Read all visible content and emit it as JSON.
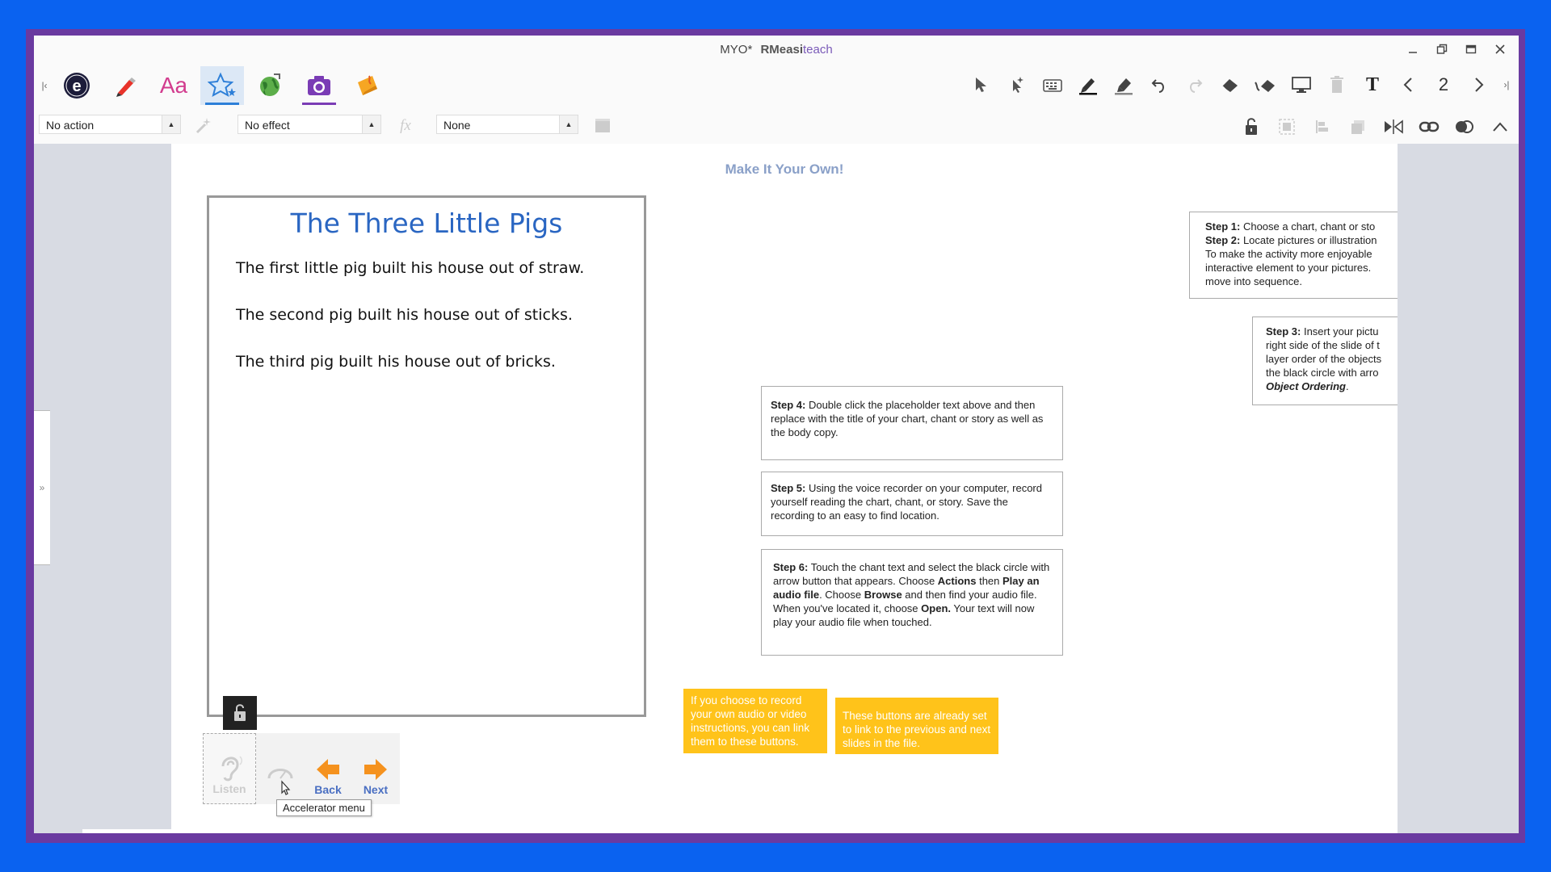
{
  "window": {
    "title": "MYO*",
    "brand_bold": "RM",
    "brand_rest": "easi",
    "brand_accent": "teach",
    "buttons": [
      "minimize-icon",
      "restore-icon",
      "maximize-icon",
      "close-icon"
    ]
  },
  "toolbar": {
    "left_tools": [
      "easiteach-logo",
      "pen-tool",
      "text-tool",
      "star-tool",
      "globe-tool",
      "camera-tool",
      "sticky-tool"
    ],
    "page_number": "2"
  },
  "properties": {
    "action_value": "No action",
    "effect_value": "No effect",
    "third_value": "None"
  },
  "slide": {
    "title": "Make It Your Own!",
    "story": {
      "heading": "The Three Little Pigs",
      "lines": [
        "The first little pig built his house out of straw.",
        "The second pig built his house out of sticks.",
        "The third pig built his house out of bricks."
      ]
    },
    "steps": {
      "s1_label": "Step 1:",
      "s1_text": " Choose a chart, chant or sto",
      "s2_label": "Step 2:",
      "s2_text": " Locate pictures or illustration",
      "s2_line3": "To make the activity more enjoyable",
      "s2_line4": "interactive element to your pictures.",
      "s2_line5": "move into sequence.",
      "s3_label": "Step 3:",
      "s3_text": " Insert your pictu",
      "s3_line2": "right side of the slide of t",
      "s3_line3": "layer order of the objects",
      "s3_line4": "the black circle with arro",
      "s3_line5": "Object Ordering",
      "s4_label": "Step 4:",
      "s4_text": " Double click the placeholder text above and then replace with the title of your chart, chant or story as well as the body copy.",
      "s5_label": "Step 5:",
      "s5_text": " Using the voice recorder on your computer, record yourself reading the chart, chant, or story. Save the recording to an easy to find location.",
      "s6_label": "Step 6:",
      "s6_a": " Touch the chant text and select the black circle with arrow button that appears. Choose ",
      "s6_b": "Actions",
      "s6_c": " then ",
      "s6_d": "Play an audio file",
      "s6_e": ". Choose ",
      "s6_f": "Browse",
      "s6_g": " and then find your audio file. When you've located it, choose ",
      "s6_h": "Open.",
      "s6_i": " Your text will now play your audio file when touched."
    },
    "callouts": {
      "left": "If you choose to record your own audio or video instructions, you can link them to these buttons.",
      "right": "These buttons are already set to link to the previous and next slides in the file."
    },
    "controls": {
      "listen": "Listen",
      "back": "Back",
      "next": "Next",
      "tooltip": "Accelerator menu"
    }
  },
  "colors": {
    "background": "#0a62f0",
    "frame": "#6a3aa0",
    "story_heading": "#2a66c2",
    "callout": "#ffc31a",
    "control_label": "#4a6fc2",
    "arrow": "#f5921e"
  }
}
